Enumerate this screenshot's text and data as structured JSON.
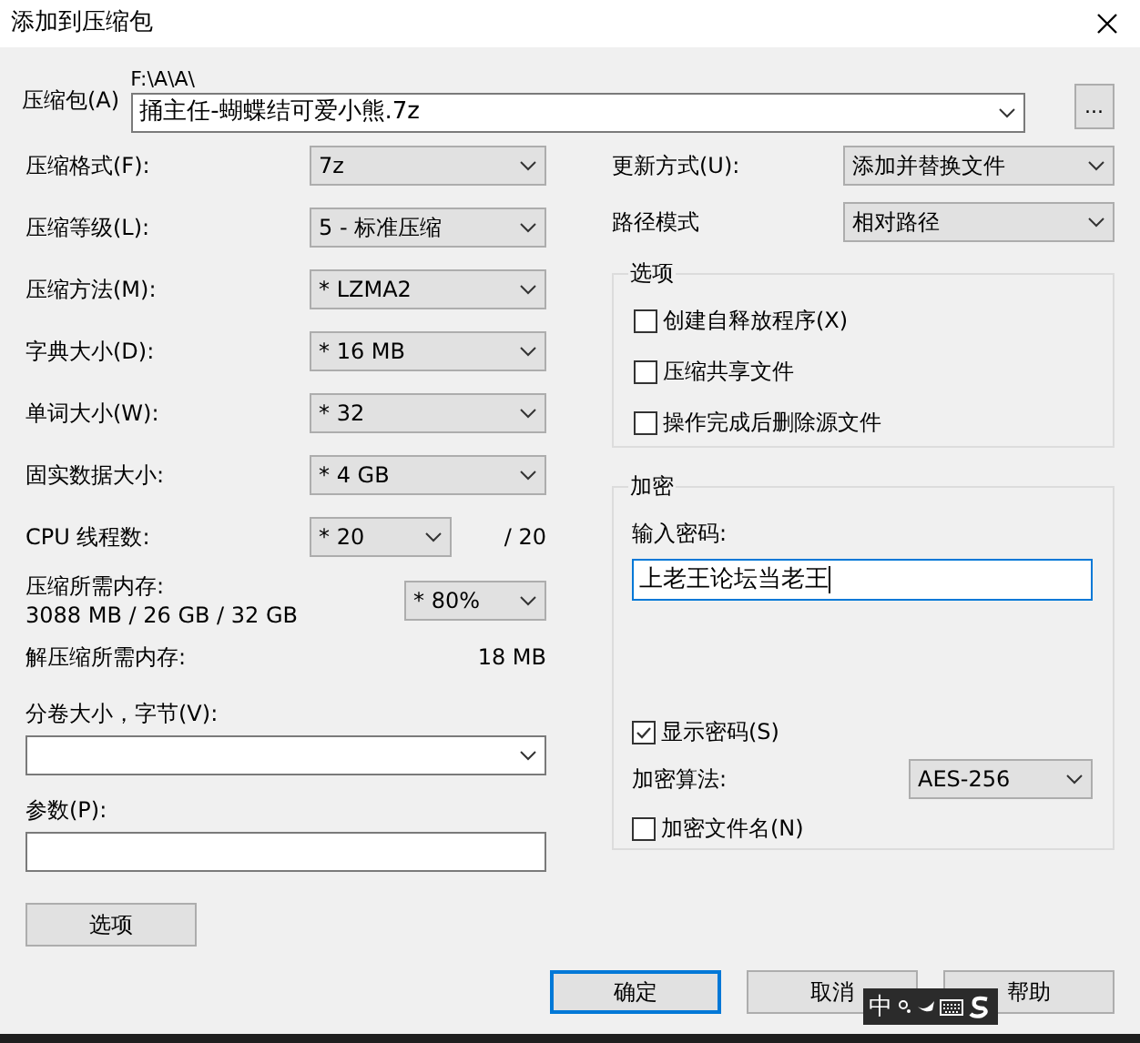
{
  "window": {
    "title": "添加到压缩包"
  },
  "archive": {
    "label": "压缩包(A)",
    "path": "F:\\A\\A\\",
    "value": "捅主任-蝴蝶结可爱小熊.7z",
    "browse": "..."
  },
  "settings": [
    {
      "label": "压缩格式(F):",
      "value": "7z"
    },
    {
      "label": "压缩等级(L):",
      "value": "5 - 标准压缩"
    },
    {
      "label": "压缩方法(M):",
      "value": "* LZMA2"
    },
    {
      "label": "字典大小(D):",
      "value": "* 16 MB"
    },
    {
      "label": "单词大小(W):",
      "value": "* 32"
    },
    {
      "label": "固实数据大小:",
      "value": "* 4 GB"
    }
  ],
  "cpu_threads": {
    "label": "CPU 线程数:",
    "value": "* 20",
    "total": "/ 20"
  },
  "compress_memory": {
    "label": "压缩所需内存:",
    "detail": "3088 MB / 26 GB / 32 GB",
    "value": "* 80%"
  },
  "decompress_memory": {
    "label": "解压缩所需内存:",
    "value": "18 MB"
  },
  "volume_size": {
    "label": "分卷大小，字节(V):"
  },
  "parameters": {
    "label": "参数(P):"
  },
  "options_button": "选项",
  "update_mode": {
    "label": "更新方式(U):",
    "value": "添加并替换文件"
  },
  "path_mode": {
    "label": "路径模式",
    "value": "相对路径"
  },
  "options_group": {
    "title": "选项",
    "items": [
      {
        "label": "创建自释放程序(X)",
        "checked": false
      },
      {
        "label": "压缩共享文件",
        "checked": false
      },
      {
        "label": "操作完成后删除源文件",
        "checked": false
      }
    ]
  },
  "encryption": {
    "title": "加密",
    "password_label": "输入密码:",
    "password": "上老王论坛当老王",
    "show_password": {
      "label": "显示密码(S)",
      "checked": true
    },
    "method_label": "加密算法:",
    "method": "AES-256",
    "encrypt_names": {
      "label": "加密文件名(N)",
      "checked": false
    }
  },
  "buttons": [
    {
      "label": "确定",
      "default": true
    },
    {
      "label": "取消",
      "default": false
    },
    {
      "label": "帮助",
      "default": false
    }
  ],
  "ime_bar": {
    "label": "中"
  }
}
